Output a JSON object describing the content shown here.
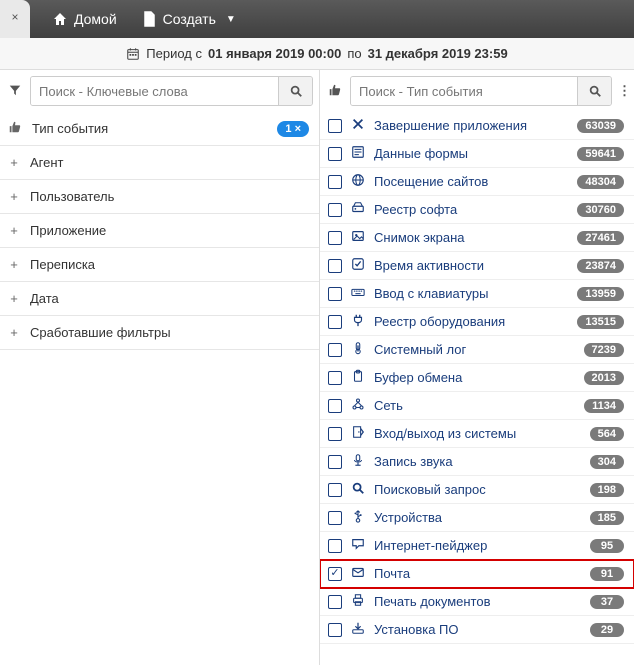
{
  "topbar": {
    "home_label": "Домой",
    "create_label": "Создать"
  },
  "period": {
    "prefix": "Период с",
    "from": "01 января 2019 00:00",
    "mid": "по",
    "to": "31 декабря 2019 23:59"
  },
  "left": {
    "search_placeholder": "Поиск - Ключевые слова",
    "header": {
      "label": "Тип события",
      "badge": "1 ×"
    },
    "groups": [
      {
        "label": "Агент"
      },
      {
        "label": "Пользователь"
      },
      {
        "label": "Приложение"
      },
      {
        "label": "Переписка"
      },
      {
        "label": "Дата"
      },
      {
        "label": "Сработавшие фильтры"
      }
    ]
  },
  "right": {
    "search_placeholder": "Поиск - Тип события",
    "events": [
      {
        "icon": "x",
        "label": "Завершение приложения",
        "count": "63039",
        "checked": false
      },
      {
        "icon": "form",
        "label": "Данные формы",
        "count": "59641",
        "checked": false
      },
      {
        "icon": "globe",
        "label": "Посещение сайтов",
        "count": "48304",
        "checked": false
      },
      {
        "icon": "drive",
        "label": "Реестр софта",
        "count": "30760",
        "checked": false
      },
      {
        "icon": "image",
        "label": "Снимок экрана",
        "count": "27461",
        "checked": false
      },
      {
        "icon": "check",
        "label": "Время активности",
        "count": "23874",
        "checked": false
      },
      {
        "icon": "keyboard",
        "label": "Ввод с клавиатуры",
        "count": "13959",
        "checked": false
      },
      {
        "icon": "plug",
        "label": "Реестр оборудования",
        "count": "13515",
        "checked": false
      },
      {
        "icon": "thermo",
        "label": "Системный лог",
        "count": "7239",
        "checked": false
      },
      {
        "icon": "clipboard",
        "label": "Буфер обмена",
        "count": "2013",
        "checked": false
      },
      {
        "icon": "network",
        "label": "Сеть",
        "count": "1134",
        "checked": false
      },
      {
        "icon": "door",
        "label": "Вход/выход из системы",
        "count": "564",
        "checked": false
      },
      {
        "icon": "mic",
        "label": "Запись звука",
        "count": "304",
        "checked": false
      },
      {
        "icon": "search",
        "label": "Поисковый запрос",
        "count": "198",
        "checked": false
      },
      {
        "icon": "usb",
        "label": "Устройства",
        "count": "185",
        "checked": false
      },
      {
        "icon": "chat",
        "label": "Интернет-пейджер",
        "count": "95",
        "checked": false
      },
      {
        "icon": "mail",
        "label": "Почта",
        "count": "91",
        "checked": true,
        "highlight": true
      },
      {
        "icon": "printer",
        "label": "Печать документов",
        "count": "37",
        "checked": false
      },
      {
        "icon": "install",
        "label": "Установка ПО",
        "count": "29",
        "checked": false
      }
    ]
  }
}
